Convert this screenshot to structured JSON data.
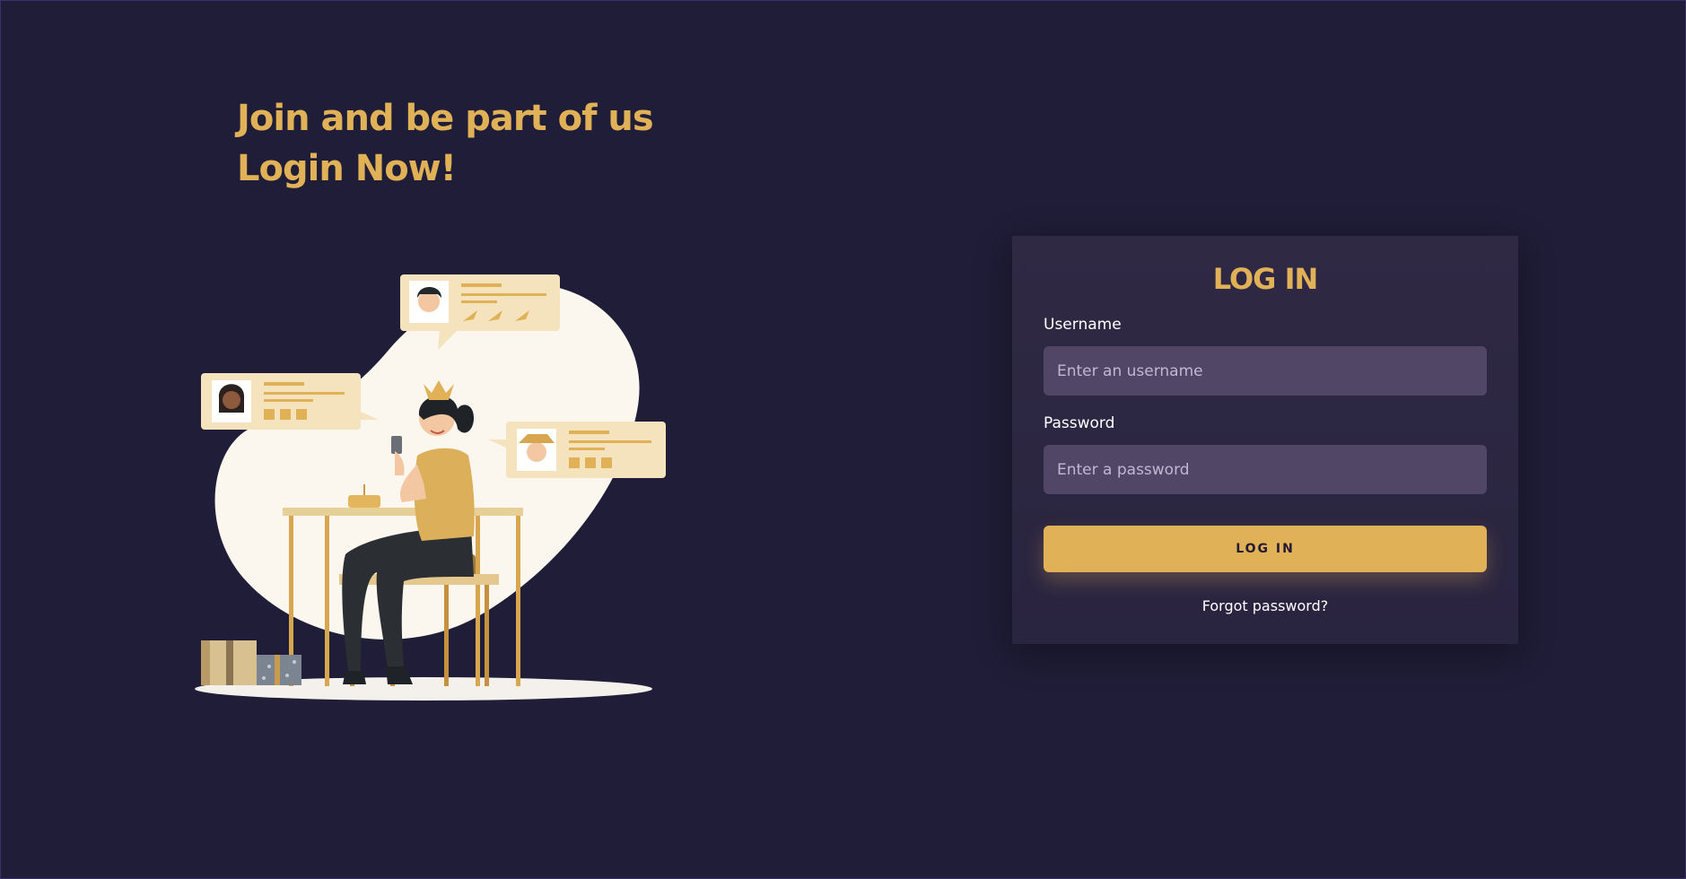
{
  "hero": {
    "line1": "Join and be part of us",
    "line2": "Login Now!"
  },
  "login": {
    "title": "LOG IN",
    "username_label": "Username",
    "username_placeholder": "Enter an username",
    "password_label": "Password",
    "password_placeholder": "Enter a password",
    "button_label": "LOG IN",
    "forgot_label": "Forgot password?"
  },
  "colors": {
    "background": "#1f1d37",
    "accent": "#e1b158",
    "card": "#2f2944",
    "input": "#524667"
  },
  "illustration": {
    "description_icon": "woman-with-crown-chatting-illustration"
  }
}
